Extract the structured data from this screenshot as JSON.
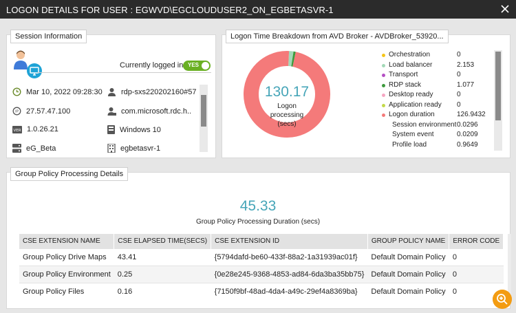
{
  "window": {
    "title": "LOGON DETAILS FOR USER : EGWVD\\EGCLOUDUSER2_ON_EGBETASVR-1"
  },
  "session": {
    "title": "Session Information",
    "logged_in_label": "Currently logged in",
    "logged_in_toggle": "YES",
    "rows": [
      {
        "icon": "clock-icon",
        "value": "Mar 10, 2022 09:28:30"
      },
      {
        "icon": "user-icon",
        "value": "rdp-sxs220202160#57"
      },
      {
        "icon": "ip-icon",
        "value": "27.57.47.100"
      },
      {
        "icon": "user-id-icon",
        "value": "com.microsoft.rdc.h.."
      },
      {
        "icon": "version-icon",
        "value": "1.0.26.21"
      },
      {
        "icon": "os-icon",
        "value": "Windows 10"
      },
      {
        "icon": "server-icon",
        "value": "eG_Beta"
      },
      {
        "icon": "building-icon",
        "value": "egbetasvr-1"
      }
    ]
  },
  "logon": {
    "title": "Logon Time Breakdown from AVD Broker - AVDBroker_53920...",
    "total_value": "130.17",
    "total_label": [
      "Logon",
      "processing",
      "(secs)"
    ],
    "legend": [
      {
        "name": "Orchestration",
        "value": "0",
        "color": "#f5c518"
      },
      {
        "name": "Load balancer",
        "value": "2.153",
        "color": "#a3d9b8"
      },
      {
        "name": "Transport",
        "value": "0",
        "color": "#b44fc4"
      },
      {
        "name": "RDP stack",
        "value": "1.077",
        "color": "#3d9a3d"
      },
      {
        "name": "Desktop ready",
        "value": "0",
        "color": "#f6a6c2"
      },
      {
        "name": "Application ready",
        "value": "0",
        "color": "#c3d94a"
      },
      {
        "name": "Logon duration",
        "value": "126.9432",
        "color": "#f47a7a"
      }
    ],
    "sub_items": [
      {
        "name": "Session environment",
        "value": "0.0296"
      },
      {
        "name": "System event",
        "value": "0.0209"
      },
      {
        "name": "Profile load",
        "value": "0.9649"
      }
    ]
  },
  "chart_data": {
    "type": "pie",
    "categories": [
      "Orchestration",
      "Load balancer",
      "Transport",
      "RDP stack",
      "Desktop ready",
      "Application ready",
      "Logon duration"
    ],
    "values": [
      0,
      2.153,
      0,
      1.077,
      0,
      0,
      126.9432
    ],
    "colors": [
      "#f5c518",
      "#a3d9b8",
      "#b44fc4",
      "#3d9a3d",
      "#f6a6c2",
      "#c3d94a",
      "#f47a7a"
    ]
  },
  "gp": {
    "title": "Group Policy Processing Details",
    "duration_value": "45.33",
    "duration_label": "Group Policy Processing Duration (secs)",
    "columns": [
      "CSE EXTENSION NAME",
      "CSE ELAPSED TIME(SECS)",
      "CSE EXTENSION ID",
      "GROUP POLICY NAME",
      "ERROR CODE"
    ],
    "rows": [
      [
        "Group Policy Drive Maps",
        "43.41",
        "{5794dafd-be60-433f-88a2-1a31939ac01f}",
        "Default Domain Policy",
        "0"
      ],
      [
        "Group Policy Environment",
        "0.25",
        "{0e28e245-9368-4853-ad84-6da3ba35bb75}",
        "Default Domain Policy",
        "0"
      ],
      [
        "Group Policy Files",
        "0.16",
        "{7150f9bf-48ad-4da4-a49c-29ef4a8369ba}",
        "Default Domain Policy",
        "0"
      ]
    ]
  }
}
